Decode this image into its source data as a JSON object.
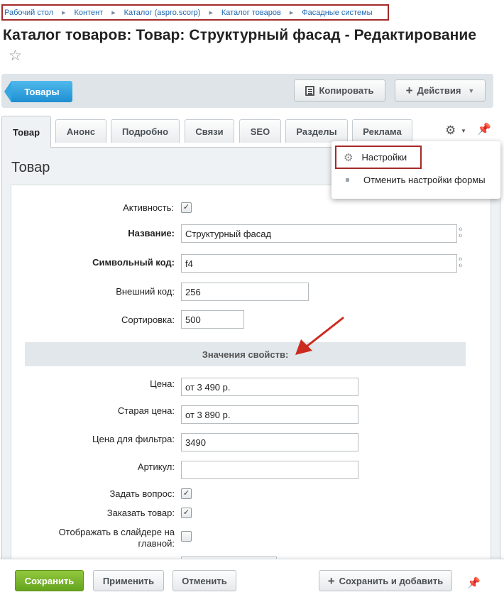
{
  "breadcrumb": [
    "Рабочий стол",
    "Контент",
    "Каталог (aspro.scorp)",
    "Каталог товаров",
    "Фасадные системы"
  ],
  "page": {
    "title": "Каталог товаров: Товар: Структурный фасад - Редактирование"
  },
  "toolbar": {
    "back_label": "Товары",
    "copy_label": "Копировать",
    "actions_label": "Действия"
  },
  "tabs": [
    "Товар",
    "Анонс",
    "Подробно",
    "Связи",
    "SEO",
    "Разделы",
    "Реклама"
  ],
  "settings_menu": {
    "item_settings": "Настройки",
    "item_reset": "Отменить настройки формы"
  },
  "section": {
    "title": "Товар"
  },
  "fields": {
    "active_label": "Активность:",
    "active_checked": true,
    "name_label": "Название:",
    "name_value": "Структурный фасад",
    "code_label": "Символьный код:",
    "code_value": "f4",
    "ext_code_label": "Внешний код:",
    "ext_code_value": "256",
    "sort_label": "Сортировка:",
    "sort_value": "500"
  },
  "properties": {
    "header": "Значения свойств:",
    "price_label": "Цена:",
    "price_value": "от 3 490 р.",
    "old_price_label": "Старая цена:",
    "old_price_value": "от 3 890 р.",
    "filter_price_label": "Цена для фильтра:",
    "filter_price_value": "3490",
    "article_label": "Артикул:",
    "article_value": "",
    "ask_label": "Задать вопрос:",
    "ask_checked": true,
    "order_label": "Заказать товар:",
    "order_checked": true,
    "slider_label_line1": "Отображать в слайдере на",
    "slider_label_line2": "главной:",
    "slider_checked": false
  },
  "footer": {
    "save_label": "Сохранить",
    "apply_label": "Применить",
    "cancel_label": "Отменить",
    "save_add_label": "Сохранить и добавить"
  },
  "colors": {
    "link": "#2067b0",
    "highlight_border": "#a52a2a",
    "save_green": "#65a31e",
    "back_blue": "#1e8fd2",
    "arrow_red": "#cc2a1e"
  }
}
